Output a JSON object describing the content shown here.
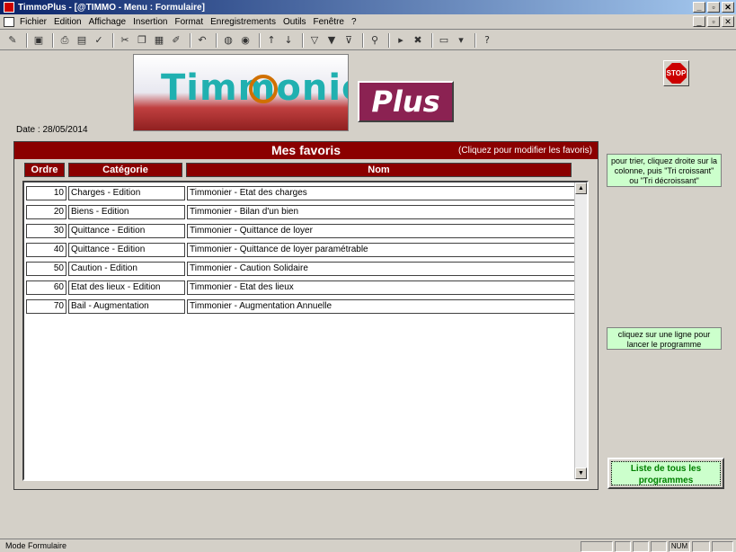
{
  "window": {
    "title": "TimmoPlus - [@TIMMO - Menu : Formulaire]"
  },
  "menu": {
    "items": [
      "Fichier",
      "Edition",
      "Affichage",
      "Insertion",
      "Format",
      "Enregistrements",
      "Outils",
      "Fenêtre",
      "?"
    ]
  },
  "logo": {
    "text": "Timmonier",
    "plus": "Plus"
  },
  "stop_label": "STOP",
  "date": "Date : 28/05/2014",
  "favorites": {
    "title": "Mes favoris",
    "hint": "(Cliquez pour modifier les favoris)",
    "col_order": "Ordre",
    "col_category": "Catégorie",
    "col_name": "Nom",
    "rows": [
      {
        "order": "10",
        "category": "Charges - Edition",
        "name": "Timmonier - Etat des charges"
      },
      {
        "order": "20",
        "category": "Biens - Edition",
        "name": "Timmonier - Bilan d'un bien"
      },
      {
        "order": "30",
        "category": "Quittance - Edition",
        "name": "Timmonier - Quittance de loyer"
      },
      {
        "order": "40",
        "category": "Quittance - Edition",
        "name": "Timmonier - Quittance de loyer paramétrable"
      },
      {
        "order": "50",
        "category": "Caution - Edition",
        "name": "Timmonier - Caution Solidaire"
      },
      {
        "order": "60",
        "category": "Etat des lieux - Edition",
        "name": "Timmonier - Etat des lieux"
      },
      {
        "order": "70",
        "category": "Bail - Augmentation",
        "name": "Timmonier - Augmentation Annuelle"
      }
    ]
  },
  "notes": {
    "sort": "pour trier, cliquez droite sur la colonne, puis \"Tri croissant\" ou \"Tri décroissant\"",
    "launch": "cliquez sur une ligne pour lancer le programme"
  },
  "all_programs_button": "Liste de tous les programmes",
  "status": {
    "mode": "Mode Formulaire",
    "num": "NUM"
  }
}
